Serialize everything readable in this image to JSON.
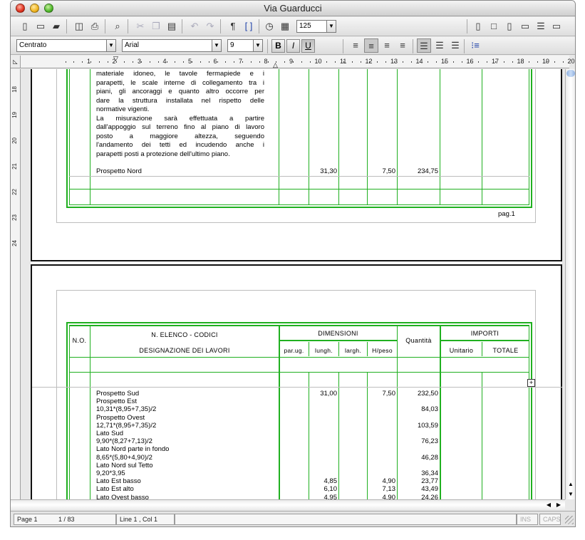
{
  "window": {
    "title": "Via Guarducci"
  },
  "toolbar": {
    "zoom": "125"
  },
  "format": {
    "style": "Centrato",
    "font": "Arial",
    "size": "9"
  },
  "ruler": {
    "h_numbers": [
      "1",
      "2",
      "3",
      "4",
      "5",
      "6",
      "7",
      "8",
      "9",
      "10",
      "11",
      "12",
      "13",
      "14",
      "15",
      "16",
      "17",
      "18",
      "19",
      "20"
    ],
    "v_numbers": [
      "18",
      "19",
      "20",
      "21",
      "22",
      "23",
      "24"
    ]
  },
  "page1": {
    "text_lines": [
      "materiale idoneo, le tavole fermapiede e i",
      "parapetti, le scale interne di collegamento tra i",
      "piani, gli ancoraggi e quanto altro occorre per",
      "dare la struttura installata nel rispetto delle",
      "normative vigenti.",
      "La misurazione sarà effettuata a partire",
      "dall'appoggio sul terreno fino al piano di lavoro",
      "posto a maggiore altezza, seguendo",
      "l'andamento dei tetti ed incudendo anche i",
      "parapetti posti a protezione dell'ultimo piano."
    ],
    "row": {
      "label": "Prospetto Nord",
      "lungh": "31,30",
      "hpeso": "7,50",
      "qty": "234,75"
    },
    "footer": "pag.1"
  },
  "page2": {
    "headers": {
      "no": "N.O.",
      "elenco": "N. ELENCO - CODICI",
      "designazione": "DESIGNAZIONE DEI LAVORI",
      "dimensioni": "DIMENSIONI",
      "parug": "par.ug.",
      "lungh": "lungh.",
      "largh": "largh.",
      "hpeso": "H/peso",
      "quantita": "Quantità",
      "importi": "IMPORTI",
      "unitario": "Unitario",
      "totale": "TOTALE"
    },
    "rows": [
      {
        "label": "Prospetto Sud",
        "lungh": "31,00",
        "largh": "",
        "hpeso": "7,50",
        "qty": "232,50"
      },
      {
        "label": "Prospetto Est",
        "lungh": "",
        "largh": "",
        "hpeso": "",
        "qty": ""
      },
      {
        "label": "10,31*(8,95+7,35)/2",
        "lungh": "",
        "largh": "",
        "hpeso": "",
        "qty": "84,03"
      },
      {
        "label": "Prospetto Ovest",
        "lungh": "",
        "largh": "",
        "hpeso": "",
        "qty": ""
      },
      {
        "label": "12,71*(8,95+7,35)/2",
        "lungh": "",
        "largh": "",
        "hpeso": "",
        "qty": "103,59"
      },
      {
        "label": "Lato Sud",
        "lungh": "",
        "largh": "",
        "hpeso": "",
        "qty": ""
      },
      {
        "label": "9,90*(8,27+7,13)/2",
        "lungh": "",
        "largh": "",
        "hpeso": "",
        "qty": "76,23"
      },
      {
        "label": "Lato Nord parte in fondo",
        "lungh": "",
        "largh": "",
        "hpeso": "",
        "qty": ""
      },
      {
        "label": "8,65*(5,80+4,90)/2",
        "lungh": "",
        "largh": "",
        "hpeso": "",
        "qty": "46,28"
      },
      {
        "label": "Lato Nord sul Tetto",
        "lungh": "",
        "largh": "",
        "hpeso": "",
        "qty": ""
      },
      {
        "label": "9,20*3,95",
        "lungh": "",
        "largh": "",
        "hpeso": "",
        "qty": "36,34"
      },
      {
        "label": "Lato Est basso",
        "lungh": "4,85",
        "largh": "",
        "hpeso": "4,90",
        "qty": "23,77"
      },
      {
        "label": "Lato Est alto",
        "lungh": "6,10",
        "largh": "",
        "hpeso": "7,13",
        "qty": "43,49"
      },
      {
        "label": "Lato Ovest basso",
        "lungh": "4,95",
        "largh": "",
        "hpeso": "4,90",
        "qty": "24,26"
      }
    ]
  },
  "status": {
    "page": "Page 1",
    "count": "1 / 83",
    "position": "Line 1 , Col 1",
    "ins": "INS",
    "caps": "CAPS"
  }
}
